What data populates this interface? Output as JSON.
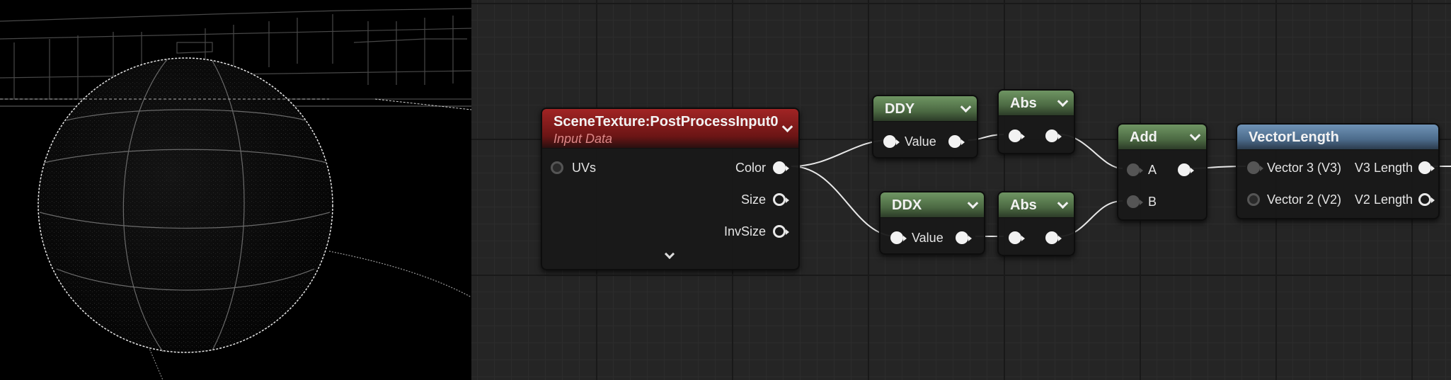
{
  "viewport": {
    "description_icon": "viewport-preview"
  },
  "graph": {
    "scene_texture": {
      "title": "SceneTexture:PostProcessInput0",
      "subtitle": "Input Data",
      "inputs": [
        "UVs"
      ],
      "outputs": [
        "Color",
        "Size",
        "InvSize"
      ]
    },
    "ddy": {
      "title": "DDY",
      "pin_label": "Value"
    },
    "ddx": {
      "title": "DDX",
      "pin_label": "Value"
    },
    "abs_top": {
      "title": "Abs"
    },
    "abs_bottom": {
      "title": "Abs"
    },
    "add": {
      "title": "Add",
      "inputs": [
        "A",
        "B"
      ]
    },
    "vector_length": {
      "title": "VectorLength",
      "inputs": [
        "Vector 3 (V3)",
        "Vector 2 (V2)"
      ],
      "outputs": [
        "V3 Length",
        "V2 Length"
      ]
    }
  },
  "colors": {
    "graph_background": "#252525",
    "header_scene_texture": "#a12424",
    "header_math": "#4c6a43",
    "header_vector": "#4c6b8b",
    "wire": "#e8e8e8"
  }
}
